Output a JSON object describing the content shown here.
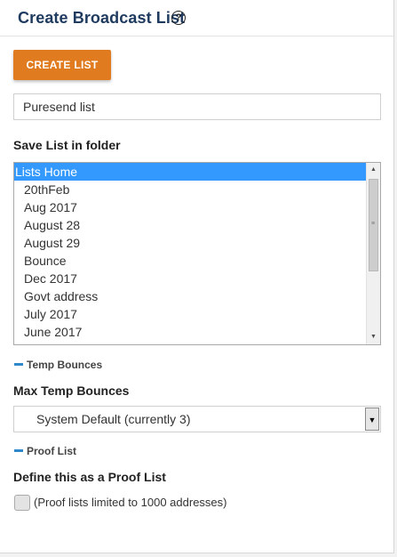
{
  "header": {
    "title": "Create Broadcast List",
    "help_icon_glyph": "?"
  },
  "create_button": {
    "label": "CREATE LIST"
  },
  "list_name": {
    "value": "Puresend list"
  },
  "folder": {
    "label": "Save List in folder",
    "items": [
      "Lists Home",
      "20thFeb",
      "Aug 2017",
      "August 28",
      "August 29",
      "Bounce",
      "Dec 2017",
      "Govt address",
      "July 2017",
      "June 2017"
    ],
    "selected_index": 0
  },
  "temp_bounces": {
    "section_title": "Temp Bounces",
    "label": "Max Temp Bounces",
    "selected": "System Default (currently 3)"
  },
  "proof_list": {
    "section_title": "Proof List",
    "label": "Define this as a Proof List",
    "checkbox_label": "(Proof lists limited to 1000 addresses)",
    "checked": false
  },
  "colors": {
    "accent_button": "#e07b1f",
    "title": "#1f3a5f",
    "selection": "#3399ff",
    "section_toggle": "#2f88c9"
  }
}
